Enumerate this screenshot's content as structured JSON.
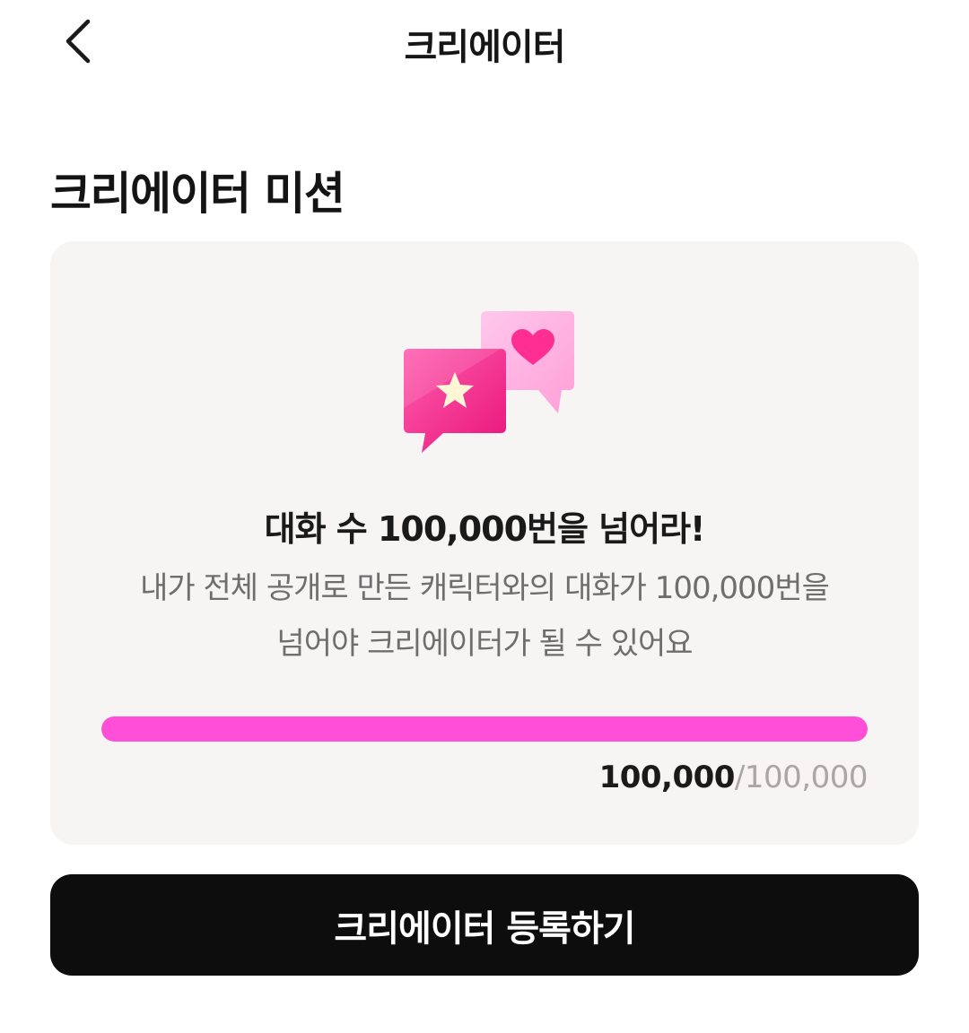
{
  "app_bar": {
    "title": "크리에이터",
    "back_icon": "chevron-left-icon"
  },
  "section": {
    "title": "크리에이터 미션"
  },
  "mission": {
    "icon": "chat-bubbles-star-heart-icon",
    "title": "대화 수 100,000번을 넘어라!",
    "description": "내가 전체 공개로 만든 캐릭터와의 대화가 100,000번을\n넘어야 크리에이터가 될 수 있어요",
    "progress": {
      "current": "100,000",
      "separator": "/",
      "goal": "100,000",
      "fraction": 1.0
    }
  },
  "register_button": {
    "label": "크리에이터 등록하기"
  },
  "colors": {
    "progress_fill": "#ff4fd8",
    "bubble_front": "#f5358f",
    "bubble_back": "#ffb3e2",
    "button_bg": "#0d0d0d",
    "card_bg": "#f6f5f4"
  }
}
